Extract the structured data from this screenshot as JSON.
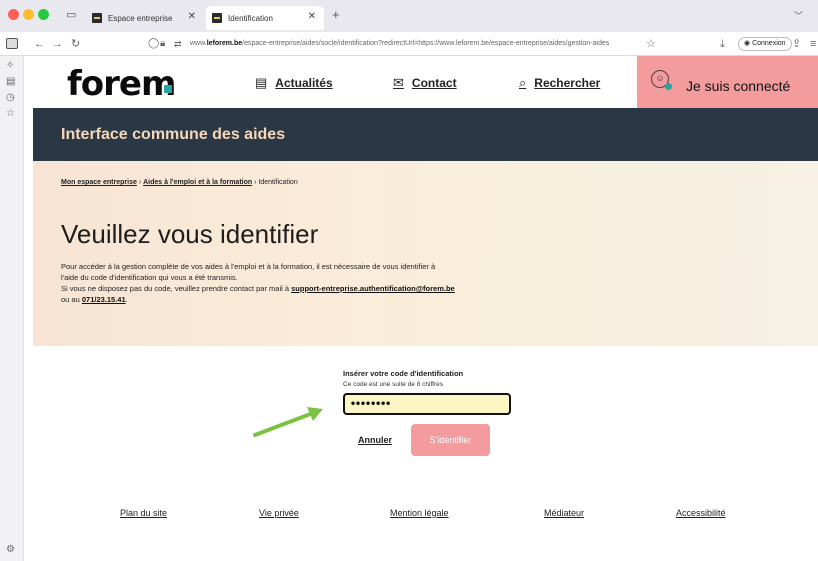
{
  "browser": {
    "tabs": [
      {
        "label": "Espace entreprise",
        "active": false
      },
      {
        "label": "Identification",
        "active": true
      }
    ],
    "new_tab": "+",
    "url_prefix": "www.",
    "url_domain": "leforem.be",
    "url_rest": "/espace-entreprise/aides/socle/identification?redirectUrl=https://www.leforem.be/espace-entreprise/aides/gestion-aides",
    "connexion_label": "Connexion"
  },
  "header": {
    "logo_text": "forem",
    "nav": [
      {
        "label": "Actualités",
        "icon": "newspaper-icon"
      },
      {
        "label": "Contact",
        "icon": "mail-icon"
      },
      {
        "label": "Rechercher",
        "icon": "search-icon"
      }
    ],
    "connected_label": "Je suis connecté"
  },
  "banner": {
    "title": "Interface commune des aides"
  },
  "breadcrumb": {
    "items": [
      "Mon espace entreprise",
      "Aides à l'emploi et à la formation",
      "Identification"
    ],
    "separator": "›"
  },
  "hero": {
    "title": "Veuillez vous identifier",
    "line1": "Pour accéder à la gestion complète de vos aides à l'emploi et à la formation, il est nécessaire de vous identifier à",
    "line2": "l'aide du code d'identification qui vous a été transmis.",
    "line3_prefix": "Si vous ne disposez pas du code, veuillez prendre contact par mail à ",
    "email": "support-entreprise.authentification@forem.be",
    "line4_prefix": "ou au ",
    "phone": "071/23.15.41",
    "line4_suffix": "."
  },
  "form": {
    "label": "Insérer votre code d'identification",
    "hint": "Ce code est une suite de 8 chiffres",
    "value": "••••••••",
    "cancel_label": "Annuler",
    "submit_label": "S'identifier"
  },
  "footer": {
    "links": [
      "Plan du site",
      "Vie privée",
      "Mention légale",
      "Médiateur",
      "Accessibilité"
    ]
  },
  "colors": {
    "accent_pink": "#f39b9d",
    "banner_dark": "#2a3745",
    "banner_text": "#f6d8b8",
    "logo_teal": "#27a6a4",
    "arrow_green": "#7cc242"
  }
}
